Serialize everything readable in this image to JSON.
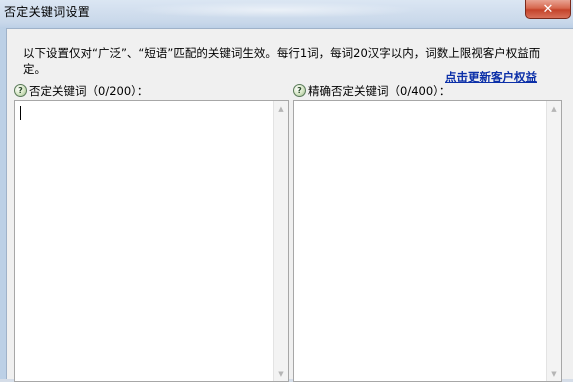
{
  "window": {
    "title": "否定关键词设置",
    "close_glyph": "✕"
  },
  "description": "以下设置仅对“广泛”、“短语”匹配的关键词生效。每行1词，每词20汉字以内，词数上限视客户权益而定。",
  "update_link": "点击更新客户权益",
  "help_glyph": "?",
  "negative_keywords": {
    "label": "否定关键词（0/200）：",
    "value": ""
  },
  "exact_negative_keywords": {
    "label": "精确否定关键词（0/400）：",
    "value": ""
  },
  "scroll": {
    "up_glyph": "▲",
    "down_glyph": "▼"
  },
  "colors": {
    "link": "#0b2fa8",
    "close_button": "#c4432a",
    "dialog_bg": "#f0f0f0"
  }
}
